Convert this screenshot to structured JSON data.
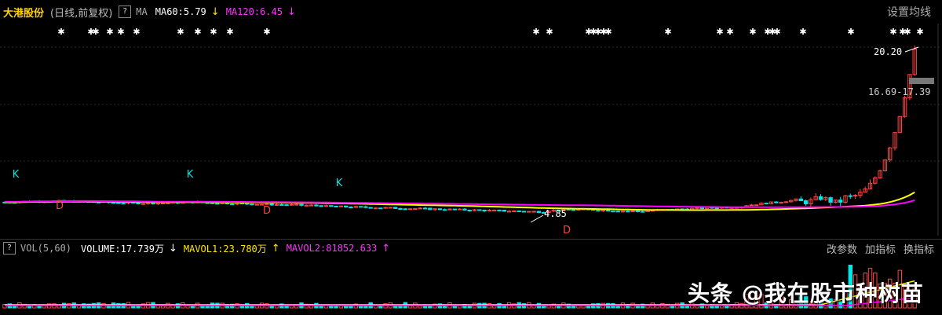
{
  "header": {
    "stock_name": "大港股份",
    "period": "(日线,前复权)",
    "help": "?",
    "ma_label": "MA",
    "ma60": "MA60:5.79",
    "ma60_arrow": "↓",
    "ma120": "MA120:6.45",
    "ma120_arrow": "↓",
    "settings_button": "设置均线"
  },
  "volume_header": {
    "help": "?",
    "vol_label": "VOL(5,60)",
    "volume": "VOLUME:17.739万",
    "volume_arrow": "↓",
    "mavol1": "MAVOL1:23.780万",
    "mavol1_arrow": "↑",
    "mavol2": "MAVOL2:81852.633",
    "mavol2_arrow": "↑",
    "buttons": [
      "改参数",
      "加指标",
      "换指标"
    ]
  },
  "price_annotations": {
    "high": "20.20",
    "range": "16.69-17.39",
    "low": "4.85"
  },
  "signals": {
    "k": "K",
    "d": "D"
  },
  "watermark": "头条 @我在股市种树苗",
  "colors": {
    "up": "#ff4444",
    "down": "#00e5e5",
    "ma60": "#ffff00",
    "ma120": "#ff00ff",
    "bg": "#000000"
  },
  "chart_data": {
    "type": "candlestick",
    "indicators": [
      "MA60",
      "MA120",
      "VOL(5,60)"
    ],
    "last_close_range": [
      16.69,
      17.39
    ],
    "recent_high": 20.2,
    "period_low": 4.85,
    "ma60_value": 5.79,
    "ma120_value": 6.45,
    "volume": "17.739万",
    "mavol1": "23.780万",
    "mavol2": 81852.633
  }
}
